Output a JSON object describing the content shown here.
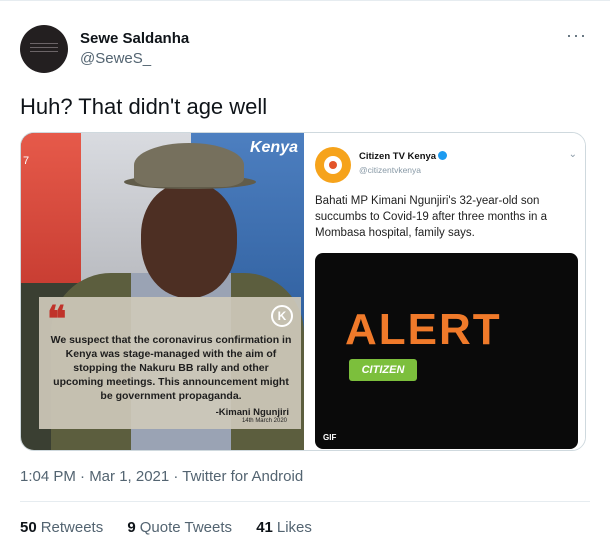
{
  "tweet": {
    "author": {
      "display_name": "Sewe Saldanha",
      "handle": "@SeweS_"
    },
    "more_icon": "more-horizontal-icon",
    "text": "Huh? That didn't age well",
    "timestamp": "1:04 PM · Mar 1, 2021 · Twitter for Android",
    "stats": [
      {
        "count": "50",
        "label": "Retweets"
      },
      {
        "count": "9",
        "label": "Quote Tweets"
      },
      {
        "count": "41",
        "label": "Likes"
      }
    ]
  },
  "media": {
    "left_image": {
      "brand": "Kenya",
      "page_marker": "7",
      "quote_mark": "❝",
      "badge": "K",
      "quote": "We suspect that the coronavirus confirmation in Kenya was stage-managed with the aim of stopping the Nakuru BB rally and other upcoming meetings. This announcement might be government propaganda.",
      "author": "-Kimani Ngunjiri",
      "date": "14th March 2020"
    },
    "right_image": {
      "account_name": "Citizen TV Kenya",
      "account_handle": "@citizentvkenya",
      "text": "Bahati MP Kimani Ngunjiri's 32-year-old son succumbs to Covid-19 after three months in a Mombasa hospital, family says.",
      "alert": "ALERT",
      "citizen_badge": "CITIZEN",
      "gif_label": "GIF"
    }
  },
  "colors": {
    "text_primary": "#0f1419",
    "text_secondary": "#536471",
    "alert_orange": "#f07a2a",
    "citizen_green": "#7cbf3c",
    "verified_blue": "#1d9bf0"
  }
}
